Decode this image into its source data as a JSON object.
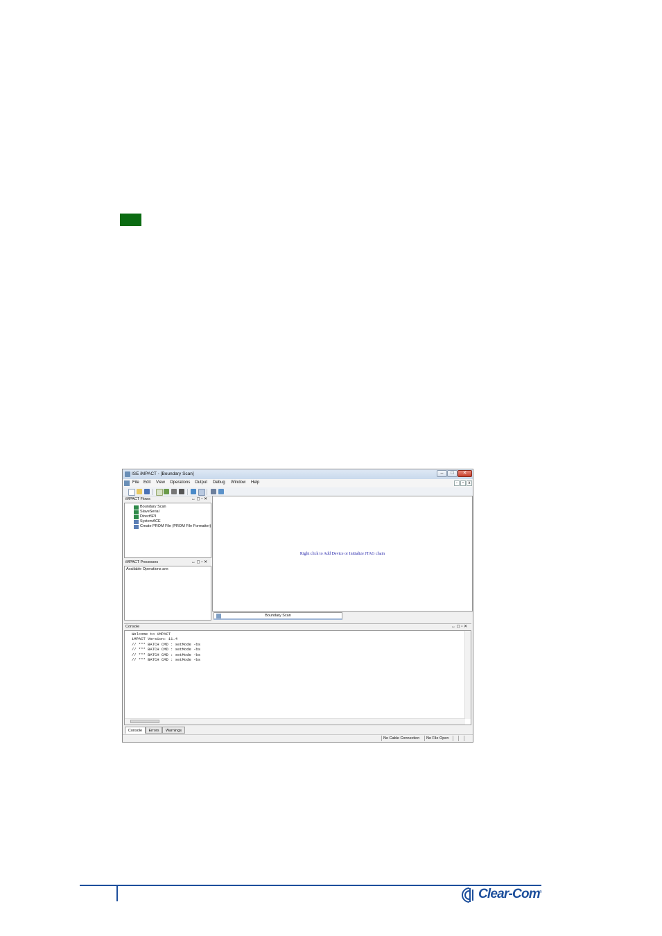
{
  "window": {
    "title": "ISE iMPACT - [Boundary Scan]",
    "menu": [
      "File",
      "Edit",
      "View",
      "Operations",
      "Output",
      "Debug",
      "Window",
      "Help"
    ]
  },
  "flows_panel": {
    "title": "iMPACT Flows",
    "items": [
      "Boundary Scan",
      "SlaveSerial",
      "DirectSPI",
      "SystemACE",
      "Create PROM File (PROM File Formatter)"
    ]
  },
  "processes_panel": {
    "title": "iMPACT Processes",
    "body": "Available Operations are:"
  },
  "main_area": {
    "hint": "Right click to Add Device or Initialize JTAG chain",
    "tab": "Boundary Scan"
  },
  "console": {
    "title": "Console",
    "lines": [
      "Welcome to iMPACT",
      "iMPACT Version: 11.4",
      "// *** BATCH CMD : setMode -bs",
      "// *** BATCH CMD : setMode -bs",
      "// *** BATCH CMD : setMode -bs",
      "// *** BATCH CMD : setMode -bs"
    ],
    "tabs": [
      "Console",
      "Errors",
      "Warnings"
    ]
  },
  "status": {
    "cable": "No Cable Connection",
    "file": "No File Open"
  },
  "footer": {
    "logo_text": "Clear-Com",
    "logo_mark": "®"
  },
  "colors": {
    "marker": "#0b6b12",
    "brand": "#1d4f9c",
    "hint_text": "#1f1fa8"
  }
}
